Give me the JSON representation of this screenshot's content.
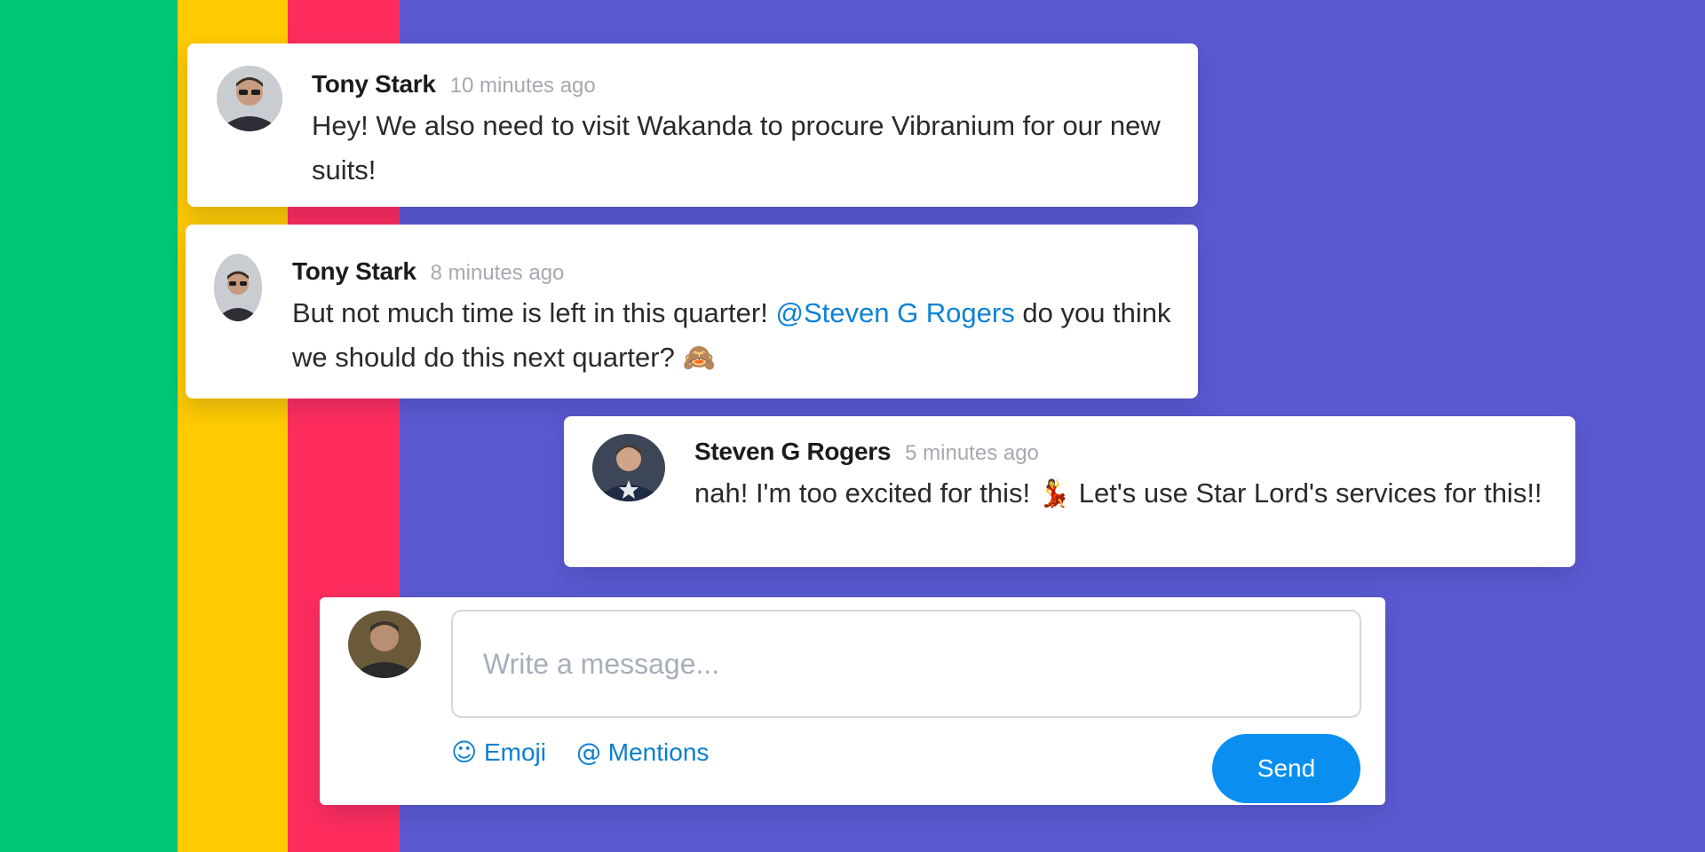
{
  "colors": {
    "background": "#5b5ad2",
    "stripe_green": "#00c875",
    "stripe_yellow": "#ffcb00",
    "stripe_red": "#ff2d5e",
    "mention": "#0d82d6",
    "send_button": "#0a8ff0"
  },
  "messages": [
    {
      "author": "Tony Stark",
      "time": "10 minutes ago",
      "text": "Hey! We also need to visit Wakanda to procure Vibranium for our new suits!"
    },
    {
      "author": "Tony Stark",
      "time": "8 minutes ago",
      "text_before": "But not much time is left in this quarter!",
      "mention": "@Steven G Rogers",
      "text_after": "do you think we should do this next quarter?",
      "emoji": "🙈"
    },
    {
      "author": "Steven G Rogers",
      "time": "5 minutes ago",
      "text_before": "nah! I'm too excited for this!",
      "emoji": "💃",
      "text_after": "Let's use Star Lord's services for this!!"
    }
  ],
  "composer": {
    "placeholder": "Write a message...",
    "emoji_icon": "☺",
    "emoji_label": "Emoji",
    "mentions_icon": "@",
    "mentions_label": "Mentions",
    "send_label": "Send"
  }
}
